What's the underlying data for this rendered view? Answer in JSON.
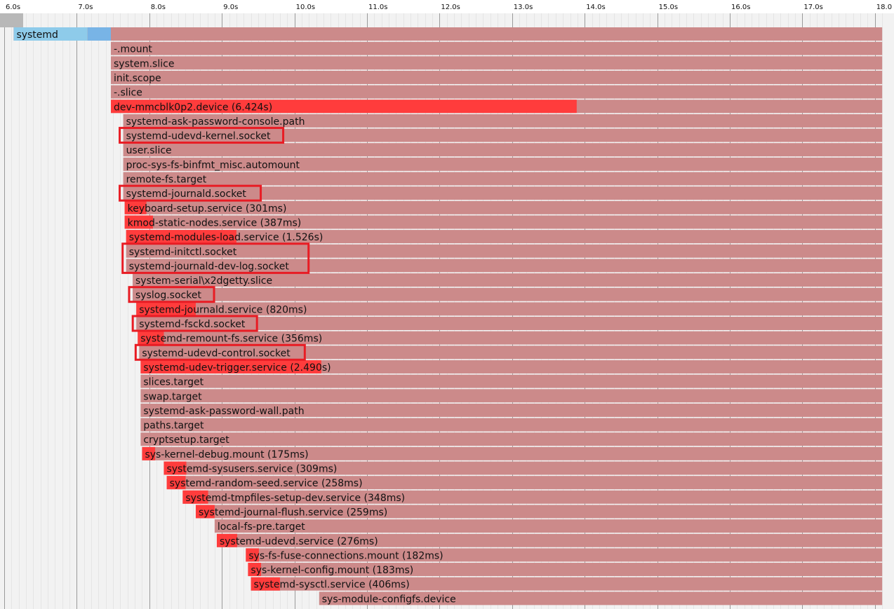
{
  "chart_data": {
    "type": "gantt",
    "x_unit": "s",
    "xlim": [
      6.0,
      18.1
    ],
    "grid": true,
    "ticks": [
      {
        "value": 6,
        "label": "6.0s"
      },
      {
        "value": 7,
        "label": "7.0s"
      },
      {
        "value": 8,
        "label": "8.0s"
      },
      {
        "value": 9,
        "label": "9.0s"
      },
      {
        "value": 10,
        "label": "10.0s"
      },
      {
        "value": 11,
        "label": "11.0s"
      },
      {
        "value": 12,
        "label": "12.0s"
      },
      {
        "value": 13,
        "label": "13.0s"
      },
      {
        "value": 14,
        "label": "14.0s"
      },
      {
        "value": 15,
        "label": "15.0s"
      },
      {
        "value": 16,
        "label": "16.0s"
      },
      {
        "value": 17,
        "label": "17.0s"
      },
      {
        "value": 18,
        "label": "18.0"
      }
    ],
    "colors": {
      "active": "#cc8a8a",
      "activating": "#ff3c3c",
      "firmware_segment": "#8ecbea",
      "kernel_segment": "#78b4e6",
      "header_block": "#b8b8b8",
      "grid_major": "#9a9a9a",
      "grid_minor": "#e5e5e5",
      "stripe": "#f2f2f2",
      "highlight_box": "#e81c24"
    },
    "units": [
      {
        "label": "systemd",
        "start": 6.13,
        "end": 18.1,
        "activating_end": 7.47,
        "segments": [
          {
            "start": 6.13,
            "end": 7.15,
            "color": "#8ecbea"
          },
          {
            "start": 7.15,
            "end": 7.47,
            "color": "#78b4e6"
          }
        ]
      },
      {
        "label": "-.mount",
        "start": 7.47,
        "end": 18.1
      },
      {
        "label": "system.slice",
        "start": 7.47,
        "end": 18.1
      },
      {
        "label": "init.scope",
        "start": 7.47,
        "end": 18.1
      },
      {
        "label": "-.slice",
        "start": 7.47,
        "end": 18.1
      },
      {
        "label": "dev-mmcblk0p2.device (6.424s)",
        "start": 7.47,
        "end": 18.1,
        "activating_end": 13.89
      },
      {
        "label": "systemd-ask-password-console.path",
        "start": 7.64,
        "end": 18.1
      },
      {
        "label": "systemd-udevd-kernel.socket",
        "start": 7.64,
        "end": 18.1
      },
      {
        "label": "user.slice",
        "start": 7.64,
        "end": 18.1
      },
      {
        "label": "proc-sys-fs-binfmt_misc.automount",
        "start": 7.64,
        "end": 18.1
      },
      {
        "label": "remote-fs.target",
        "start": 7.64,
        "end": 18.1
      },
      {
        "label": "systemd-journald.socket",
        "start": 7.64,
        "end": 18.1
      },
      {
        "label": "keyboard-setup.service (301ms)",
        "start": 7.66,
        "end": 18.1,
        "activating_end": 7.96
      },
      {
        "label": "kmod-static-nodes.service (387ms)",
        "start": 7.66,
        "end": 18.1,
        "activating_end": 8.05
      },
      {
        "label": "systemd-modules-load.service (1.526s)",
        "start": 7.68,
        "end": 18.1,
        "activating_end": 9.2
      },
      {
        "label": "systemd-initctl.socket",
        "start": 7.68,
        "end": 18.1
      },
      {
        "label": "systemd-journald-dev-log.socket",
        "start": 7.68,
        "end": 18.1
      },
      {
        "label": "system-serial\\x2dgetty.slice",
        "start": 7.77,
        "end": 18.1
      },
      {
        "label": "syslog.socket",
        "start": 7.77,
        "end": 18.1
      },
      {
        "label": "systemd-journald.service (820ms)",
        "start": 7.82,
        "end": 18.1,
        "activating_end": 8.64
      },
      {
        "label": "systemd-fsckd.socket",
        "start": 7.82,
        "end": 18.1
      },
      {
        "label": "systemd-remount-fs.service (356ms)",
        "start": 7.84,
        "end": 18.1,
        "activating_end": 8.2
      },
      {
        "label": "systemd-udevd-control.socket",
        "start": 7.86,
        "end": 18.1
      },
      {
        "label": "systemd-udev-trigger.service (2.490s)",
        "start": 7.88,
        "end": 18.1,
        "activating_end": 10.37
      },
      {
        "label": "slices.target",
        "start": 7.88,
        "end": 18.1
      },
      {
        "label": "swap.target",
        "start": 7.88,
        "end": 18.1
      },
      {
        "label": "systemd-ask-password-wall.path",
        "start": 7.88,
        "end": 18.1
      },
      {
        "label": "paths.target",
        "start": 7.88,
        "end": 18.1
      },
      {
        "label": "cryptsetup.target",
        "start": 7.88,
        "end": 18.1
      },
      {
        "label": "sys-kernel-debug.mount (175ms)",
        "start": 7.9,
        "end": 18.1,
        "activating_end": 8.08
      },
      {
        "label": "systemd-sysusers.service (309ms)",
        "start": 8.2,
        "end": 18.1,
        "activating_end": 8.51
      },
      {
        "label": "systemd-random-seed.service (258ms)",
        "start": 8.24,
        "end": 18.1,
        "activating_end": 8.5
      },
      {
        "label": "systemd-tmpfiles-setup-dev.service (348ms)",
        "start": 8.46,
        "end": 18.1,
        "activating_end": 8.81
      },
      {
        "label": "systemd-journal-flush.service (259ms)",
        "start": 8.64,
        "end": 18.1,
        "activating_end": 8.9
      },
      {
        "label": "local-fs-pre.target",
        "start": 8.9,
        "end": 18.1
      },
      {
        "label": "systemd-udevd.service (276ms)",
        "start": 8.93,
        "end": 18.1,
        "activating_end": 9.21
      },
      {
        "label": "sys-fs-fuse-connections.mount (182ms)",
        "start": 9.33,
        "end": 18.1,
        "activating_end": 9.51
      },
      {
        "label": "sys-kernel-config.mount (183ms)",
        "start": 9.36,
        "end": 18.1,
        "activating_end": 9.54
      },
      {
        "label": "systemd-sysctl.service (406ms)",
        "start": 9.4,
        "end": 18.1,
        "activating_end": 9.8
      },
      {
        "label": "sys-module-configfs.device",
        "start": 10.34,
        "end": 18.1
      }
    ],
    "highlighted_groups": [
      [
        7
      ],
      [
        11
      ],
      [
        15,
        16
      ],
      [
        18
      ],
      [
        20
      ],
      [
        22
      ]
    ]
  }
}
